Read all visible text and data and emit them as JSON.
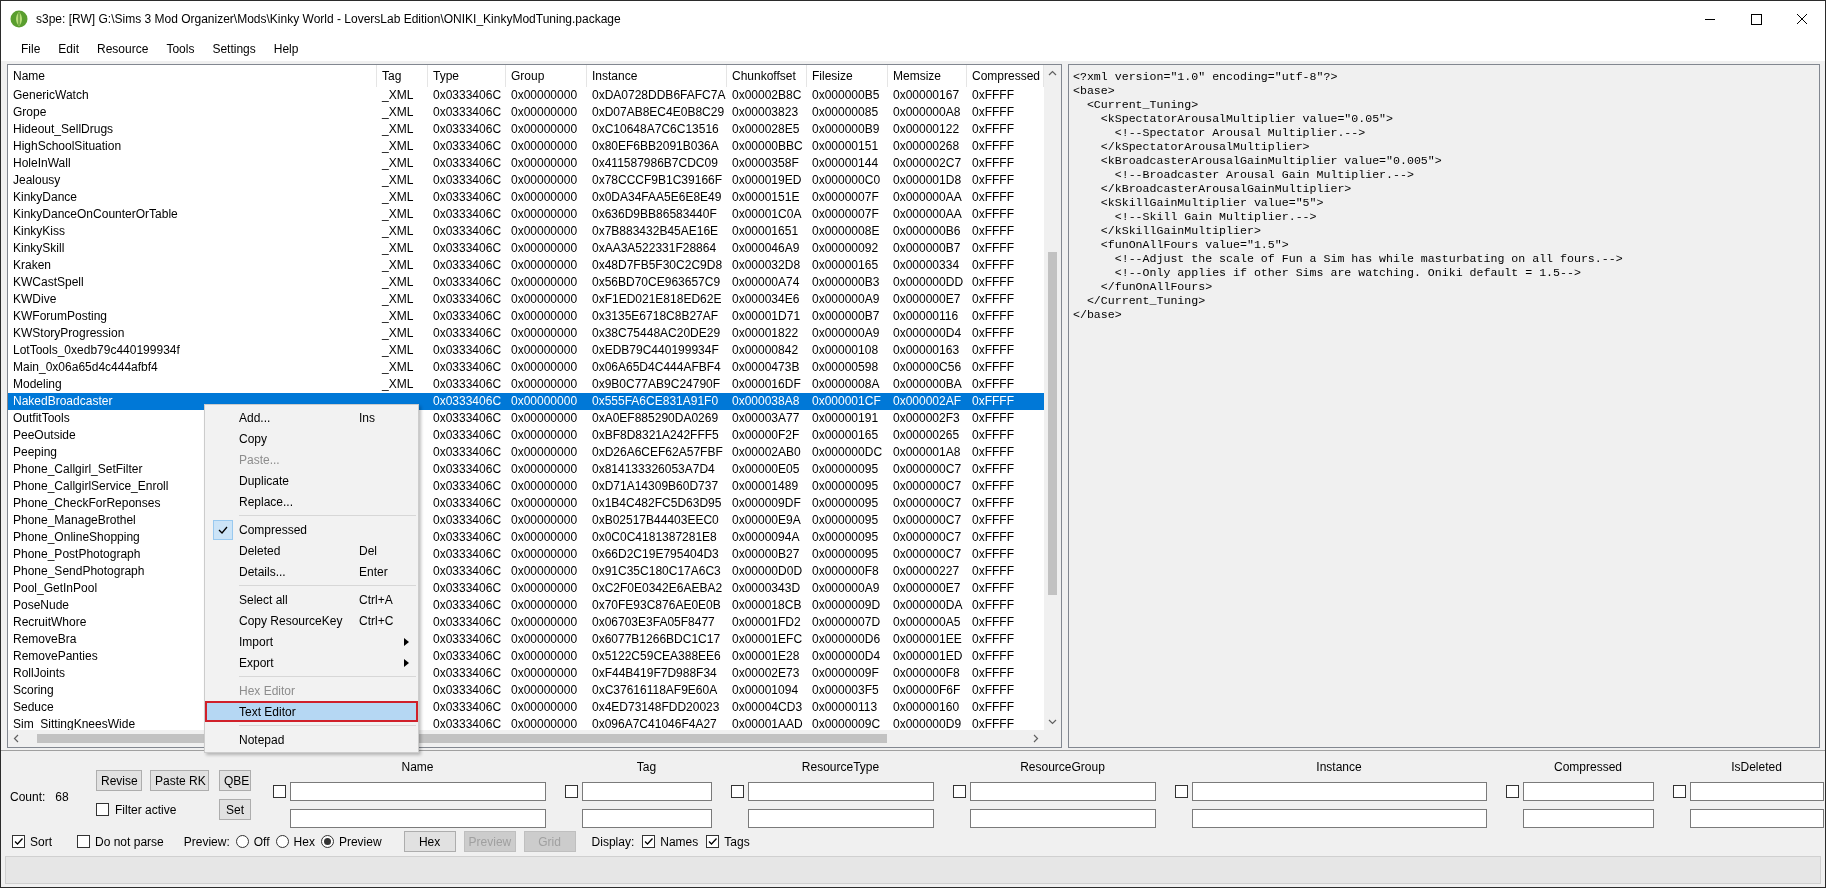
{
  "window": {
    "title": "s3pe: [RW] G:\\Sims 3 Mod Organizer\\Mods\\Kinky World - LoversLab Edition\\ONIKI_KinkyModTuning.package"
  },
  "menu_bar": [
    "File",
    "Edit",
    "Resource",
    "Tools",
    "Settings",
    "Help"
  ],
  "table": {
    "columns": [
      "Name",
      "Tag",
      "Type",
      "Group",
      "Instance",
      "Chunkoffset",
      "Filesize",
      "Memsize",
      "Compressed"
    ],
    "rows": [
      {
        "name": "GenericWatch",
        "tag": "_XML",
        "type": "0x0333406C",
        "group": "0x00000000",
        "instance": "0xDA0728DDB6FAFC7A",
        "chunkoffset": "0x00002B8C",
        "filesize": "0x000000B5",
        "memsize": "0x00000167",
        "compressed": "0xFFFF",
        "selected": false
      },
      {
        "name": "Grope",
        "tag": "_XML",
        "type": "0x0333406C",
        "group": "0x00000000",
        "instance": "0xD07AB8EC4E0B8C29",
        "chunkoffset": "0x00003823",
        "filesize": "0x00000085",
        "memsize": "0x000000A8",
        "compressed": "0xFFFF",
        "selected": false
      },
      {
        "name": "Hideout_SellDrugs",
        "tag": "_XML",
        "type": "0x0333406C",
        "group": "0x00000000",
        "instance": "0xC10648A7C6C13516",
        "chunkoffset": "0x000028E5",
        "filesize": "0x000000B9",
        "memsize": "0x00000122",
        "compressed": "0xFFFF",
        "selected": false
      },
      {
        "name": "HighSchoolSituation",
        "tag": "_XML",
        "type": "0x0333406C",
        "group": "0x00000000",
        "instance": "0x80EF6BB2091B036A",
        "chunkoffset": "0x00000BBC",
        "filesize": "0x00000151",
        "memsize": "0x00000268",
        "compressed": "0xFFFF",
        "selected": false
      },
      {
        "name": "HoleInWall",
        "tag": "_XML",
        "type": "0x0333406C",
        "group": "0x00000000",
        "instance": "0x411587986B7CDC09",
        "chunkoffset": "0x0000358F",
        "filesize": "0x00000144",
        "memsize": "0x000002C7",
        "compressed": "0xFFFF",
        "selected": false
      },
      {
        "name": "Jealousy",
        "tag": "_XML",
        "type": "0x0333406C",
        "group": "0x00000000",
        "instance": "0x78CCCF9B1C39166F",
        "chunkoffset": "0x000019ED",
        "filesize": "0x000000C0",
        "memsize": "0x000001D8",
        "compressed": "0xFFFF",
        "selected": false
      },
      {
        "name": "KinkyDance",
        "tag": "_XML",
        "type": "0x0333406C",
        "group": "0x00000000",
        "instance": "0x0DA34FAA5E6E8E49",
        "chunkoffset": "0x0000151E",
        "filesize": "0x0000007F",
        "memsize": "0x000000AA",
        "compressed": "0xFFFF",
        "selected": false
      },
      {
        "name": "KinkyDanceOnCounterOrTable",
        "tag": "_XML",
        "type": "0x0333406C",
        "group": "0x00000000",
        "instance": "0x636D9BB86583440F",
        "chunkoffset": "0x00001C0A",
        "filesize": "0x0000007F",
        "memsize": "0x000000AA",
        "compressed": "0xFFFF",
        "selected": false
      },
      {
        "name": "KinkyKiss",
        "tag": "_XML",
        "type": "0x0333406C",
        "group": "0x00000000",
        "instance": "0x7B883432B45AE16E",
        "chunkoffset": "0x00001651",
        "filesize": "0x0000008E",
        "memsize": "0x000000B6",
        "compressed": "0xFFFF",
        "selected": false
      },
      {
        "name": "KinkySkill",
        "tag": "_XML",
        "type": "0x0333406C",
        "group": "0x00000000",
        "instance": "0xAA3A522331F28864",
        "chunkoffset": "0x000046A9",
        "filesize": "0x00000092",
        "memsize": "0x000000B7",
        "compressed": "0xFFFF",
        "selected": false
      },
      {
        "name": "Kraken",
        "tag": "_XML",
        "type": "0x0333406C",
        "group": "0x00000000",
        "instance": "0x48D7FB5F30C2C9D8",
        "chunkoffset": "0x000032D8",
        "filesize": "0x00000165",
        "memsize": "0x00000334",
        "compressed": "0xFFFF",
        "selected": false
      },
      {
        "name": "KWCastSpell",
        "tag": "_XML",
        "type": "0x0333406C",
        "group": "0x00000000",
        "instance": "0x56BD70CE963657C9",
        "chunkoffset": "0x00000A74",
        "filesize": "0x000000B3",
        "memsize": "0x000000DD",
        "compressed": "0xFFFF",
        "selected": false
      },
      {
        "name": "KWDive",
        "tag": "_XML",
        "type": "0x0333406C",
        "group": "0x00000000",
        "instance": "0xF1ED021E818ED62E",
        "chunkoffset": "0x000034E6",
        "filesize": "0x000000A9",
        "memsize": "0x000000E7",
        "compressed": "0xFFFF",
        "selected": false
      },
      {
        "name": "KWForumPosting",
        "tag": "_XML",
        "type": "0x0333406C",
        "group": "0x00000000",
        "instance": "0x3135E6718C8B27AF",
        "chunkoffset": "0x00001D71",
        "filesize": "0x000000B7",
        "memsize": "0x00000116",
        "compressed": "0xFFFF",
        "selected": false
      },
      {
        "name": "KWStoryProgression",
        "tag": "_XML",
        "type": "0x0333406C",
        "group": "0x00000000",
        "instance": "0x38C75448AC20DE29",
        "chunkoffset": "0x00001822",
        "filesize": "0x000000A9",
        "memsize": "0x000000D4",
        "compressed": "0xFFFF",
        "selected": false
      },
      {
        "name": "LotTools_0xedb79c440199934f",
        "tag": "_XML",
        "type": "0x0333406C",
        "group": "0x00000000",
        "instance": "0xEDB79C440199934F",
        "chunkoffset": "0x00000842",
        "filesize": "0x00000108",
        "memsize": "0x00000163",
        "compressed": "0xFFFF",
        "selected": false
      },
      {
        "name": "Main_0x06a65d4c444afbf4",
        "tag": "_XML",
        "type": "0x0333406C",
        "group": "0x00000000",
        "instance": "0x06A65D4C444AFBF4",
        "chunkoffset": "0x0000473B",
        "filesize": "0x00000598",
        "memsize": "0x00000C56",
        "compressed": "0xFFFF",
        "selected": false
      },
      {
        "name": "Modeling",
        "tag": "_XML",
        "type": "0x0333406C",
        "group": "0x00000000",
        "instance": "0x9B0C77AB9C24790F",
        "chunkoffset": "0x000016DF",
        "filesize": "0x0000008A",
        "memsize": "0x000000BA",
        "compressed": "0xFFFF",
        "selected": false
      },
      {
        "name": "NakedBroadcaster",
        "type": "0x0333406C",
        "group": "0x00000000",
        "instance": "0x555FA6CE831A91F0",
        "chunkoffset": "0x000038A8",
        "filesize": "0x000001CF",
        "memsize": "0x000002AF",
        "compressed": "0xFFFF",
        "selected": true
      },
      {
        "name": "OutfitTools",
        "type": "0x0333406C",
        "group": "0x00000000",
        "instance": "0xA0EF885290DA0269",
        "chunkoffset": "0x00003A77",
        "filesize": "0x00000191",
        "memsize": "0x000002F3",
        "compressed": "0xFFFF",
        "selected": false
      },
      {
        "name": "PeeOutside",
        "type": "0x0333406C",
        "group": "0x00000000",
        "instance": "0xBF8D8321A242FFF5",
        "chunkoffset": "0x00000F2F",
        "filesize": "0x00000165",
        "memsize": "0x00000265",
        "compressed": "0xFFFF",
        "selected": false
      },
      {
        "name": "Peeping",
        "type": "0x0333406C",
        "group": "0x00000000",
        "instance": "0xD26A6CEF62A57FBF",
        "chunkoffset": "0x00002AB0",
        "filesize": "0x000000DC",
        "memsize": "0x000001A8",
        "compressed": "0xFFFF",
        "selected": false
      },
      {
        "name": "Phone_Callgirl_SetFilter",
        "type": "0x0333406C",
        "group": "0x00000000",
        "instance": "0x814133326053A7D4",
        "chunkoffset": "0x00000E05",
        "filesize": "0x00000095",
        "memsize": "0x000000C7",
        "compressed": "0xFFFF",
        "selected": false
      },
      {
        "name": "Phone_CallgirlService_Enroll",
        "type": "0x0333406C",
        "group": "0x00000000",
        "instance": "0xD71A14309B60D737",
        "chunkoffset": "0x00001489",
        "filesize": "0x00000095",
        "memsize": "0x000000C7",
        "compressed": "0xFFFF",
        "selected": false
      },
      {
        "name": "Phone_CheckForReponses",
        "type": "0x0333406C",
        "group": "0x00000000",
        "instance": "0x1B4C482FC5D63D95",
        "chunkoffset": "0x000009DF",
        "filesize": "0x00000095",
        "memsize": "0x000000C7",
        "compressed": "0xFFFF",
        "selected": false
      },
      {
        "name": "Phone_ManageBrothel",
        "type": "0x0333406C",
        "group": "0x00000000",
        "instance": "0xB02517B44403EEC0",
        "chunkoffset": "0x00000E9A",
        "filesize": "0x00000095",
        "memsize": "0x000000C7",
        "compressed": "0xFFFF",
        "selected": false
      },
      {
        "name": "Phone_OnlineShopping",
        "type": "0x0333406C",
        "group": "0x00000000",
        "instance": "0x0C0C4181387281E8",
        "chunkoffset": "0x0000094A",
        "filesize": "0x00000095",
        "memsize": "0x000000C7",
        "compressed": "0xFFFF",
        "selected": false
      },
      {
        "name": "Phone_PostPhotograph",
        "type": "0x0333406C",
        "group": "0x00000000",
        "instance": "0x66D2C19E795404D3",
        "chunkoffset": "0x00000B27",
        "filesize": "0x00000095",
        "memsize": "0x000000C7",
        "compressed": "0xFFFF",
        "selected": false
      },
      {
        "name": "Phone_SendPhotograph",
        "type": "0x0333406C",
        "group": "0x00000000",
        "instance": "0x91C35C180C17A6C3",
        "chunkoffset": "0x00000D0D",
        "filesize": "0x000000F8",
        "memsize": "0x00000227",
        "compressed": "0xFFFF",
        "selected": false
      },
      {
        "name": "Pool_GetInPool",
        "type": "0x0333406C",
        "group": "0x00000000",
        "instance": "0xC2F0E0342E6AEBA2",
        "chunkoffset": "0x0000343D",
        "filesize": "0x000000A9",
        "memsize": "0x000000E7",
        "compressed": "0xFFFF",
        "selected": false
      },
      {
        "name": "PoseNude",
        "type": "0x0333406C",
        "group": "0x00000000",
        "instance": "0x70FE93C876AE0E0B",
        "chunkoffset": "0x000018CB",
        "filesize": "0x0000009D",
        "memsize": "0x000000DA",
        "compressed": "0xFFFF",
        "selected": false
      },
      {
        "name": "RecruitWhore",
        "type": "0x0333406C",
        "group": "0x00000000",
        "instance": "0x06703E3FA05F8477",
        "chunkoffset": "0x00001FD2",
        "filesize": "0x0000007D",
        "memsize": "0x000000A5",
        "compressed": "0xFFFF",
        "selected": false
      },
      {
        "name": "RemoveBra",
        "type": "0x0333406C",
        "group": "0x00000000",
        "instance": "0x6077B1266BDC1C17",
        "chunkoffset": "0x00001EFC",
        "filesize": "0x000000D6",
        "memsize": "0x000001EE",
        "compressed": "0xFFFF",
        "selected": false
      },
      {
        "name": "RemovePanties",
        "type": "0x0333406C",
        "group": "0x00000000",
        "instance": "0x5122C59CEA388EE6",
        "chunkoffset": "0x00001E28",
        "filesize": "0x000000D4",
        "memsize": "0x000001ED",
        "compressed": "0xFFFF",
        "selected": false
      },
      {
        "name": "RollJoints",
        "type": "0x0333406C",
        "group": "0x00000000",
        "instance": "0xF44B419F7D988F34",
        "chunkoffset": "0x00002E73",
        "filesize": "0x0000009F",
        "memsize": "0x000000F8",
        "compressed": "0xFFFF",
        "selected": false
      },
      {
        "name": "Scoring",
        "type": "0x0333406C",
        "group": "0x00000000",
        "instance": "0xC37616118AF9E60A",
        "chunkoffset": "0x00001094",
        "filesize": "0x000003F5",
        "memsize": "0x00000F6F",
        "compressed": "0xFFFF",
        "selected": false
      },
      {
        "name": "Seduce",
        "type": "0x0333406C",
        "group": "0x00000000",
        "instance": "0x4ED73148FDD20023",
        "chunkoffset": "0x00004CD3",
        "filesize": "0x00000113",
        "memsize": "0x00000160",
        "compressed": "0xFFFF",
        "selected": false
      },
      {
        "name": "Sim_SittingKneesWide",
        "type": "0x0333406C",
        "group": "0x00000000",
        "instance": "0x096A7C41046F4A27",
        "chunkoffset": "0x00001AAD",
        "filesize": "0x0000009C",
        "memsize": "0x000000D9",
        "compressed": "0xFFFF",
        "selected": false
      }
    ]
  },
  "context_menu": {
    "items": [
      {
        "kind": "item",
        "label": "Add...",
        "shortcut": "Ins",
        "checked": false,
        "disabled": false,
        "highlighted": false,
        "submenu": false,
        "framed": false
      },
      {
        "kind": "item",
        "label": "Copy",
        "checked": false,
        "disabled": false,
        "highlighted": false,
        "submenu": false,
        "framed": false
      },
      {
        "kind": "item",
        "label": "Paste...",
        "checked": false,
        "disabled": true,
        "highlighted": false,
        "submenu": false,
        "framed": false
      },
      {
        "kind": "item",
        "label": "Duplicate",
        "checked": false,
        "disabled": false,
        "highlighted": false,
        "submenu": false,
        "framed": false
      },
      {
        "kind": "item",
        "label": "Replace...",
        "checked": false,
        "disabled": false,
        "highlighted": false,
        "submenu": false,
        "framed": false
      },
      {
        "kind": "separator"
      },
      {
        "kind": "item",
        "label": "Compressed",
        "checked": true,
        "disabled": false,
        "highlighted": false,
        "submenu": false,
        "framed": false
      },
      {
        "kind": "item",
        "label": "Deleted",
        "shortcut": "Del",
        "checked": false,
        "disabled": false,
        "highlighted": false,
        "submenu": false,
        "framed": false
      },
      {
        "kind": "item",
        "label": "Details...",
        "shortcut": "Enter",
        "checked": false,
        "disabled": false,
        "highlighted": false,
        "submenu": false,
        "framed": false
      },
      {
        "kind": "separator"
      },
      {
        "kind": "item",
        "label": "Select all",
        "shortcut": "Ctrl+A",
        "checked": false,
        "disabled": false,
        "highlighted": false,
        "submenu": false,
        "framed": false
      },
      {
        "kind": "item",
        "label": "Copy ResourceKey",
        "shortcut": "Ctrl+C",
        "checked": false,
        "disabled": false,
        "highlighted": false,
        "submenu": false,
        "framed": false
      },
      {
        "kind": "item",
        "label": "Import",
        "checked": false,
        "disabled": false,
        "highlighted": false,
        "submenu": true,
        "framed": false
      },
      {
        "kind": "item",
        "label": "Export",
        "checked": false,
        "disabled": false,
        "highlighted": false,
        "submenu": true,
        "framed": false
      },
      {
        "kind": "separator"
      },
      {
        "kind": "item",
        "label": "Hex Editor",
        "checked": false,
        "disabled": true,
        "highlighted": false,
        "submenu": false,
        "framed": false
      },
      {
        "kind": "item",
        "label": "Text Editor",
        "checked": false,
        "disabled": false,
        "highlighted": true,
        "submenu": false,
        "framed": true
      },
      {
        "kind": "separator"
      },
      {
        "kind": "item",
        "label": "Notepad",
        "checked": false,
        "disabled": false,
        "highlighted": false,
        "submenu": false,
        "framed": false
      }
    ]
  },
  "xml_preview": {
    "lines": [
      "<?xml version=\"1.0\" encoding=\"utf-8\"?>",
      "<base>",
      "  <Current_Tuning>",
      "    <kSpectatorArousalMultiplier value=\"0.05\">",
      "      <!--Spectator Arousal Multiplier.-->",
      "    </kSpectatorArousalMultiplier>",
      "    <kBroadcasterArousalGainMultiplier value=\"0.005\">",
      "      <!--Broadcaster Arousal Gain Multiplier.-->",
      "    </kBroadcasterArousalGainMultiplier>",
      "    <kSkillGainMultiplier value=\"5\">",
      "      <!--Skill Gain Multiplier.-->",
      "    </kSkillGainMultiplier>",
      "    <funOnAllFours value=\"1.5\">",
      "      <!--Adjust the scale of Fun a Sim has while masturbating on all fours.-->",
      "      <!--Only applies if other Sims are watching. Oniki default = 1.5-->",
      "    </funOnAllFours>",
      "  </Current_Tuning>",
      "</base>"
    ]
  },
  "filter_panel": {
    "count_label": "Count:",
    "count": "68",
    "buttons": [
      {
        "label": "Revise"
      },
      {
        "label": "Paste RK"
      },
      {
        "label": "QBE"
      }
    ],
    "filter_active": {
      "label": "Filter active",
      "checked": false
    },
    "set_button": "Set",
    "columns": [
      {
        "label": "Name",
        "checked": false
      },
      {
        "label": "Tag",
        "checked": false
      },
      {
        "label": "ResourceType",
        "checked": false
      },
      {
        "label": "ResourceGroup",
        "checked": false
      },
      {
        "label": "Instance",
        "checked": false
      },
      {
        "label": "Compressed",
        "checked": false
      },
      {
        "label": "IsDeleted",
        "checked": false
      }
    ]
  },
  "options_bar": {
    "sort": {
      "label": "Sort",
      "checked": true
    },
    "do_not_parse": {
      "label": "Do not parse",
      "checked": false
    },
    "preview_label": "Preview:",
    "preview_modes": [
      {
        "label": "Off",
        "selected": false
      },
      {
        "label": "Hex",
        "selected": false
      },
      {
        "label": "Preview",
        "selected": true
      }
    ],
    "buttons": [
      {
        "label": "Hex",
        "disabled": false
      },
      {
        "label": "Preview",
        "disabled": true
      },
      {
        "label": "Grid",
        "disabled": true
      }
    ],
    "display_label": "Display:",
    "display": [
      {
        "label": "Names",
        "checked": true
      },
      {
        "label": "Tags",
        "checked": true
      }
    ]
  }
}
